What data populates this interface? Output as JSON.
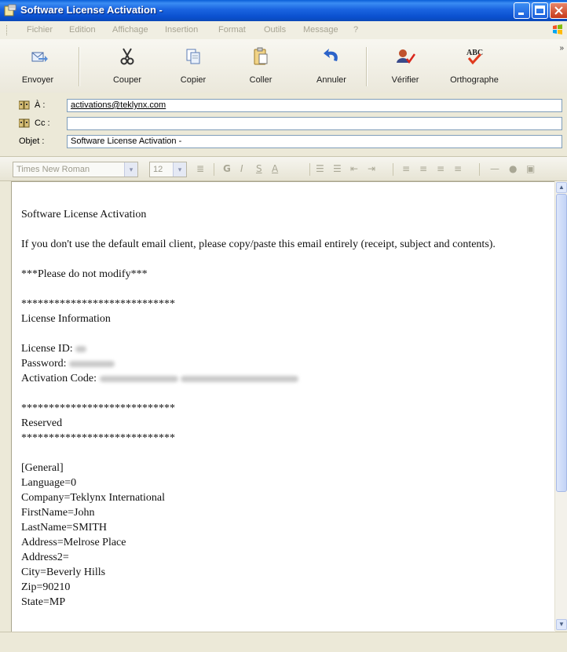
{
  "window": {
    "title": "Software License Activation -"
  },
  "menu": [
    "Fichier",
    "Edition",
    "Affichage",
    "Insertion",
    "Format",
    "Outils",
    "Message",
    "?"
  ],
  "toolbar": {
    "send_label": "Envoyer",
    "cut_label": "Couper",
    "copy_label": "Copier",
    "paste_label": "Coller",
    "undo_label": "Annuler",
    "check_label": "Vérifier",
    "spelling_label": "Orthographe",
    "spelling_badge": "ABC"
  },
  "address": {
    "to_label": "À :",
    "to_value": "activations@teklynx.com",
    "cc_label": "Cc :",
    "cc_value": "",
    "subject_label": "Objet :",
    "subject_value": "Software License Activation -"
  },
  "format_bar": {
    "font_family": "Times New Roman",
    "font_size": "12"
  },
  "message": {
    "heading": "Software License Activation",
    "intro": "If you don't use the default email client, please copy/paste this email entirely (receipt, subject and contents).",
    "warning": "***Please do not modify***",
    "separator": "****************************",
    "license_heading": "License Information",
    "license_id_label": "License ID:",
    "password_label": "Password:",
    "activation_code_label": "Activation Code:",
    "reserved_label": "Reserved",
    "config_lines": [
      "[General]",
      "Language=0",
      "Company=Teklynx International",
      "FirstName=John",
      "LastName=SMITH",
      "Address=Melrose Place",
      "Address2=",
      "City=Beverly Hills",
      "Zip=90210",
      "State=MP"
    ]
  },
  "colors": {
    "titlebar": "#0a5fd8",
    "link": "#0000ee",
    "chrome": "#ece9d8"
  }
}
